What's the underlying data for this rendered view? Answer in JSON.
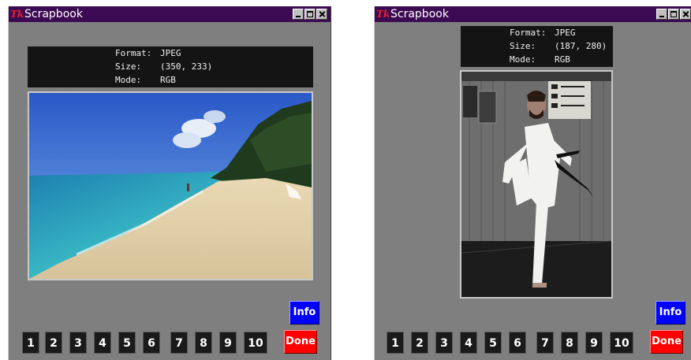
{
  "windows": [
    {
      "title": "Scrapbook",
      "info": {
        "format_label": "Format:",
        "format_value": "JPEG",
        "size_label": "Size:",
        "size_value": "(350, 233)",
        "mode_label": "Mode:",
        "mode_value": "RGB"
      },
      "image_subject": "beach-photo",
      "info_button": "Info",
      "done_button": "Done",
      "page_buttons": [
        "1",
        "2",
        "3",
        "4",
        "5",
        "6",
        "7",
        "8",
        "9",
        "10"
      ]
    },
    {
      "title": "Scrapbook",
      "info": {
        "format_label": "Format:",
        "format_value": "JPEG",
        "size_label": "Size:",
        "size_value": "(187, 280)",
        "mode_label": "Mode:",
        "mode_value": "RGB"
      },
      "image_subject": "martial-arts-photo",
      "info_button": "Info",
      "done_button": "Done",
      "page_buttons": [
        "1",
        "2",
        "3",
        "4",
        "5",
        "6",
        "7",
        "8",
        "9",
        "10"
      ]
    }
  ],
  "colors": {
    "titlebar": "#3c0a52",
    "window_bg": "#7f7f7f",
    "info_button": "#0000ff",
    "done_button": "#ff0000",
    "tk_logo": "#e8202a"
  }
}
